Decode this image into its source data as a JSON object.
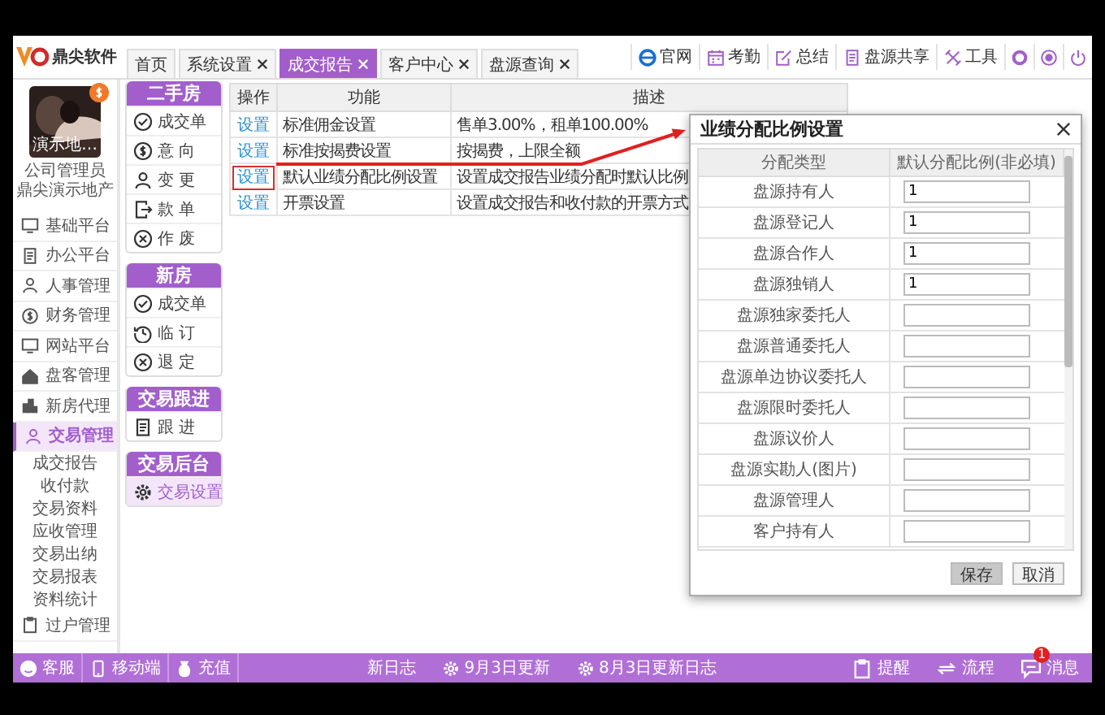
{
  "logo": {
    "text": "鼎尖软件"
  },
  "tabs": [
    {
      "label": "首页",
      "closable": false,
      "selected": false
    },
    {
      "label": "系统设置",
      "closable": true,
      "selected": false
    },
    {
      "label": "成交报告",
      "closable": true,
      "selected": true
    },
    {
      "label": "客户中心",
      "closable": true,
      "selected": false
    },
    {
      "label": "盘源查询",
      "closable": true,
      "selected": false
    }
  ],
  "toolbar": [
    {
      "label": "官网",
      "kind": "globe"
    },
    {
      "label": "考勤",
      "kind": "calendar"
    },
    {
      "label": "总结",
      "kind": "edit"
    },
    {
      "label": "盘源共享",
      "kind": "document"
    },
    {
      "label": "工具",
      "kind": "tools"
    }
  ],
  "profile": {
    "name": "演示地…",
    "role": "公司管理员",
    "company": "鼎尖演示地产"
  },
  "sidebar": {
    "items": [
      {
        "label": "基础平台",
        "selected": false
      },
      {
        "label": "办公平台",
        "selected": false
      },
      {
        "label": "人事管理",
        "selected": false
      },
      {
        "label": "财务管理",
        "selected": false
      },
      {
        "label": "网站平台",
        "selected": false
      },
      {
        "label": "盘客管理",
        "selected": false
      },
      {
        "label": "新房代理",
        "selected": false
      },
      {
        "label": "交易管理",
        "selected": true,
        "children": [
          {
            "label": "成交报告"
          },
          {
            "label": "收付款"
          },
          {
            "label": "交易资料"
          },
          {
            "label": "应收管理"
          },
          {
            "label": "交易出纳"
          },
          {
            "label": "交易报表"
          },
          {
            "label": "资料统计"
          }
        ]
      },
      {
        "label": "过户管理",
        "selected": false
      }
    ]
  },
  "menu": {
    "groups": [
      {
        "title": "二手房",
        "items": [
          {
            "label": "成交单",
            "selected": false
          },
          {
            "label": "意 向",
            "selected": false
          },
          {
            "label": "变 更",
            "selected": false
          },
          {
            "label": "款 单",
            "selected": false
          },
          {
            "label": "作 废",
            "selected": false
          }
        ]
      },
      {
        "title": "新房",
        "items": [
          {
            "label": "成交单",
            "selected": false
          },
          {
            "label": "临 订",
            "selected": false
          },
          {
            "label": "退 定",
            "selected": false
          }
        ]
      },
      {
        "title": "交易跟进",
        "items": [
          {
            "label": "跟 进",
            "selected": false
          }
        ]
      },
      {
        "title": "交易后台",
        "items": [
          {
            "label": "交易设置",
            "selected": true
          }
        ]
      }
    ]
  },
  "table": {
    "columns": [
      "操作",
      "功能",
      "描述"
    ],
    "rows": [
      {
        "action": "设置",
        "function": "标准佣金设置",
        "description": "售单3.00%，租单100.00%",
        "annotated": false
      },
      {
        "action": "设置",
        "function": "标准按揭费设置",
        "description": "按揭费，上限全额",
        "annotated": false
      },
      {
        "action": "设置",
        "function": "默认业绩分配比例设置",
        "description": "设置成交报告业绩分配时默认比例",
        "annotated": true
      },
      {
        "action": "设置",
        "function": "开票设置",
        "description": "设置成交报告和收付款的开票方式",
        "annotated": false
      }
    ]
  },
  "dialog": {
    "title": "业绩分配比例设置",
    "columns": [
      "分配类型",
      "默认分配比例(非必填)"
    ],
    "rows": [
      {
        "label": "盘源持有人",
        "value": "1"
      },
      {
        "label": "盘源登记人",
        "value": "1"
      },
      {
        "label": "盘源合作人",
        "value": "1"
      },
      {
        "label": "盘源独销人",
        "value": "1"
      },
      {
        "label": "盘源独家委托人",
        "value": ""
      },
      {
        "label": "盘源普通委托人",
        "value": ""
      },
      {
        "label": "盘源单边协议委托人",
        "value": ""
      },
      {
        "label": "盘源限时委托人",
        "value": ""
      },
      {
        "label": "盘源议价人",
        "value": ""
      },
      {
        "label": "盘源实勘人(图片)",
        "value": ""
      },
      {
        "label": "盘源管理人",
        "value": ""
      },
      {
        "label": "客户持有人",
        "value": ""
      }
    ],
    "buttons": [
      {
        "label": "保存",
        "kind": "primary"
      },
      {
        "label": "取消",
        "kind": "secondary"
      }
    ]
  },
  "footer": {
    "left": [
      {
        "label": "客服",
        "kind": "face"
      },
      {
        "label": "移动端",
        "kind": "phone"
      },
      {
        "label": "充值",
        "kind": "bag"
      }
    ],
    "center": [
      {
        "label": "新日志",
        "kind": "plain"
      },
      {
        "label": "9月3日更新",
        "kind": "gear"
      },
      {
        "label": "8月3日更新日志",
        "kind": "gear"
      }
    ],
    "right": [
      {
        "label": "提醒",
        "kind": "clipboard"
      },
      {
        "label": "流程",
        "kind": "cycle"
      },
      {
        "label": "消息",
        "kind": "chat",
        "badge": "1"
      }
    ]
  }
}
